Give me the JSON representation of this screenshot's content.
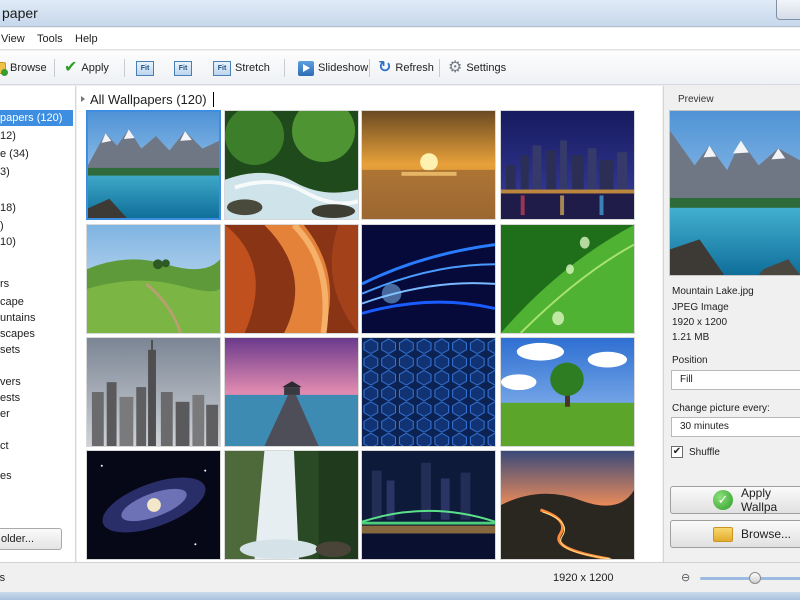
{
  "window": {
    "title": "paper"
  },
  "menu": [
    "View",
    "Tools",
    "Help"
  ],
  "toolbar": {
    "browse": "Browse",
    "apply": "Apply",
    "fit1_icon": "Fit",
    "fit2_icon": "Fit",
    "stretch_icon": "Fit",
    "stretch": "Stretch",
    "slideshow": "Slideshow",
    "refresh": "Refresh",
    "settings": "Settings"
  },
  "sidebar": {
    "items": [
      "papers (120)",
      "12)",
      "e (34)",
      "3)",
      "",
      "18)",
      ")",
      "10)",
      "",
      "rs",
      "cape",
      "untains",
      "scapes",
      "sets",
      "",
      "vers",
      "ests",
      "er",
      "",
      "ct",
      "",
      "es"
    ],
    "folder_button": "older..."
  },
  "gallery": {
    "title": "All Wallpapers (120)",
    "thumbnails": [
      "mountain-lake",
      "forest-stream",
      "sunset-beach",
      "city-night",
      "green-hills",
      "canyon",
      "blue-abstract",
      "green-leaf",
      "city-skyline",
      "pier-sunset",
      "hexagon-pattern",
      "lone-tree",
      "galaxy",
      "waterfall",
      "bridge-night",
      "winding-road"
    ]
  },
  "preview": {
    "label": "Preview",
    "filename": "Mountain Lake.jpg",
    "filetype": "JPEG Image",
    "dimensions": "1920 x 1200",
    "size": "1.21 MB",
    "position_label": "Position",
    "position_value": "Fill",
    "change_label": "Change picture every:",
    "change_value": "30 minutes",
    "shuffle_label": "Shuffle",
    "shuffle_checked": true,
    "apply_button": "Apply Wallpa",
    "browse_button": "Browse..."
  },
  "status": {
    "left": "rs",
    "resolution": "1920 x 1200",
    "zoom_percent": 50
  }
}
